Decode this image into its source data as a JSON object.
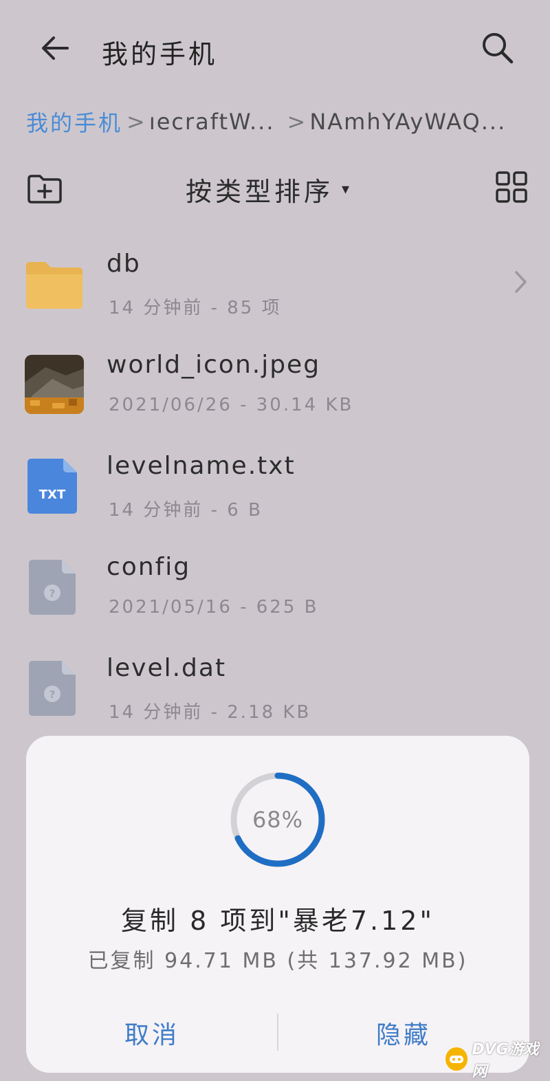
{
  "header": {
    "title": "我的手机"
  },
  "breadcrumb": {
    "home": "我的手机",
    "middle": "ıecraftW...",
    "current": "NAmhYAyWAQ...",
    "separator": ">"
  },
  "toolbar": {
    "sort_label": "按类型排序",
    "sort_caret": "▾"
  },
  "files": [
    {
      "name": "db",
      "meta": "14 分钟前 - 85 项",
      "icon": "folder-icon",
      "has_chevron": true
    },
    {
      "name": "world_icon.jpeg",
      "meta": "2021/06/26 - 30.14 KB",
      "icon": "image-thumbnail"
    },
    {
      "name": "levelname.txt",
      "meta": "14 分钟前 - 6 B",
      "icon": "txt-file-icon",
      "badge": "TXT"
    },
    {
      "name": "config",
      "meta": "2021/05/16 - 625 B",
      "icon": "unknown-file-icon"
    },
    {
      "name": "level.dat",
      "meta": "14 分钟前 - 2.18 KB",
      "icon": "unknown-file-icon"
    }
  ],
  "dialog": {
    "progress_text": "68%",
    "progress_value": 0.68,
    "title": "复制 8 项到\"暴老7.12\"",
    "subtitle": "已复制 94.71 MB (共 137.92 MB)",
    "cancel_label": "取消",
    "hide_label": "隐藏"
  },
  "watermark": {
    "text": "DVG游戏网"
  },
  "colors": {
    "background": "#cdc7cd",
    "accent": "#4a8bd6",
    "progress": "#1f6ec4",
    "folder": "#e8b350",
    "txt_icon": "#4a86dc",
    "unknown_icon": "#9ea4b4"
  }
}
